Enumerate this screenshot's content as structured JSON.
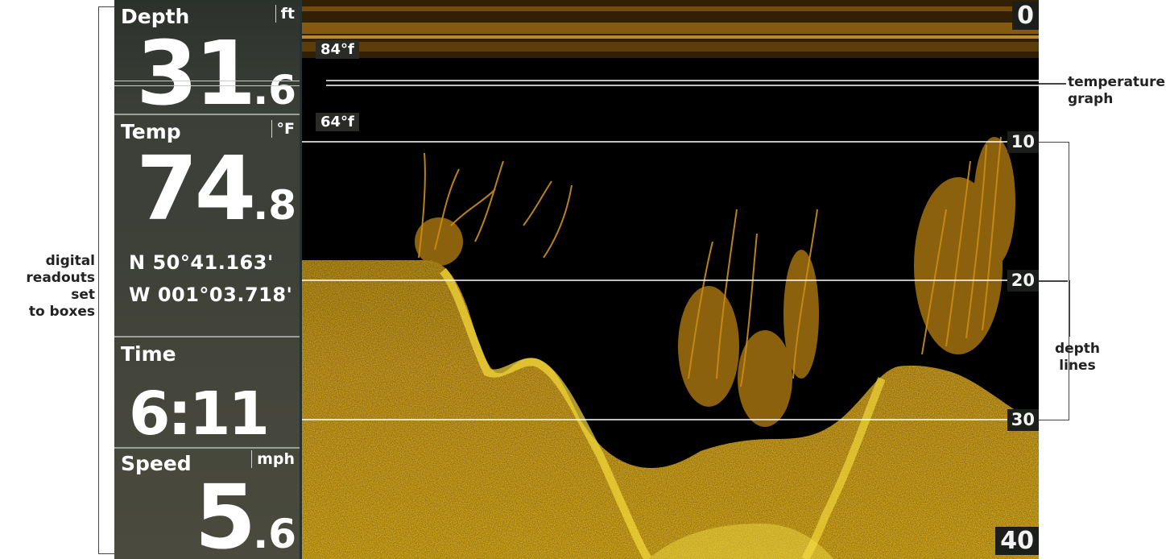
{
  "annotations": {
    "digital_readouts": [
      "digital",
      "readouts set",
      "to boxes"
    ],
    "temperature_graph": [
      "temperature",
      "graph"
    ],
    "depth_lines": [
      "depth",
      "lines"
    ]
  },
  "readouts": {
    "depth": {
      "label": "Depth",
      "unit": "ft",
      "whole": "31",
      "decimal": ".6"
    },
    "temp": {
      "label": "Temp",
      "unit": "°F",
      "whole": "74",
      "decimal": ".8"
    },
    "position": {
      "lat": "N 50°41.163'",
      "lon": "W 001°03.718'"
    },
    "time": {
      "label": "Time",
      "value": "6:11"
    },
    "speed": {
      "label": "Speed",
      "unit": "mph",
      "whole": "5",
      "decimal": ".6"
    }
  },
  "sonar": {
    "depth_labels": [
      "0",
      "10",
      "20",
      "30",
      "40"
    ],
    "temp_labels": [
      "84°f",
      "64°f"
    ]
  },
  "colors": {
    "sonar_background": "#000000",
    "bottom_return": "#e8b21e",
    "bottom_highlight": "#f6dc3a",
    "fish_arches": "#d99a18"
  }
}
